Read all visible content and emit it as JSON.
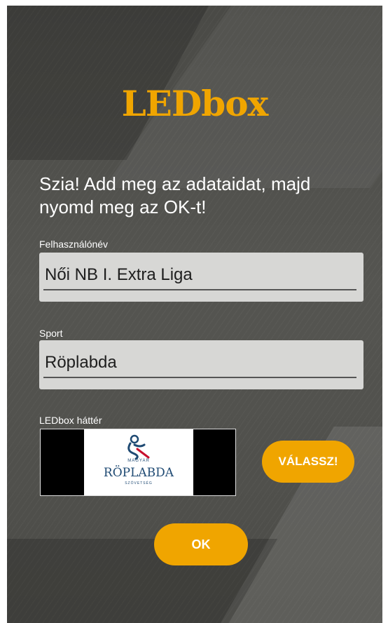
{
  "app": {
    "logo_text": "LEDbox"
  },
  "greeting": "Szia! Add meg az adataidat, majd nyomd meg az OK-t!",
  "fields": {
    "username": {
      "label": "Felhasználónév",
      "value": "Női NB I. Extra Liga"
    },
    "sport": {
      "label": "Sport",
      "value": "Röplabda"
    }
  },
  "background": {
    "label": "LEDbox háttér",
    "image_text": {
      "line1": "MAGYAR",
      "line2": "RÖPLABDA",
      "line3": "SZÖVETSÉG"
    }
  },
  "buttons": {
    "choose_label": "VÁLASSZ!",
    "ok_label": "OK"
  },
  "colors": {
    "accent": "#f0a500",
    "background": "#4f4f4b",
    "field_bg": "#d7d7d5",
    "brand_blue": "#1f4a73",
    "brand_red": "#c8102e"
  }
}
